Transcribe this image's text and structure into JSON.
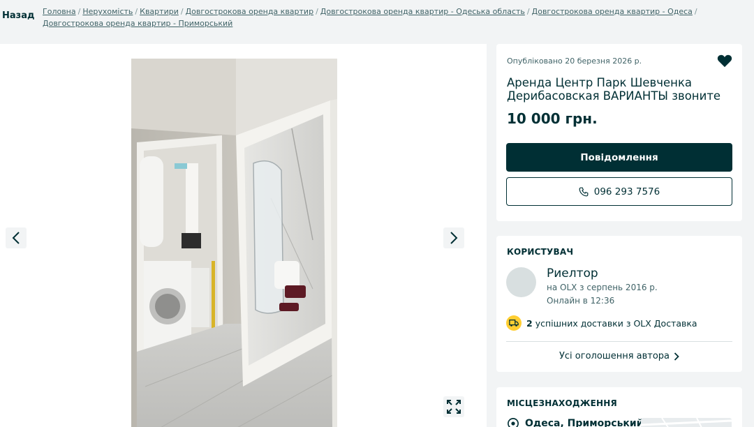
{
  "header": {
    "back_label": "Назад",
    "breadcrumbs": [
      "Головна",
      "Нерухомість",
      "Квартири",
      "Довгострокова оренда квартир",
      "Довгострокова оренда квартир - Одеська область",
      "Довгострокова оренда квартир - Одеса",
      "Довгострокова оренда квартир - Приморський"
    ],
    "separator": "/"
  },
  "listing": {
    "posted": "Опубліковано 20 березня 2026 р.",
    "title": "Аренда Центр Парк Шевченка Дерибасовская ВАРИАНТЫ звоните",
    "price": "10 000 грн.",
    "message_button": "Повідомлення",
    "phone": "096 293 7576"
  },
  "user": {
    "section_title": "Користувач",
    "name": "Риелтор",
    "since": "на OLX з серпень 2016 р.",
    "online": "Онлайн в 12:36",
    "deliveries_count": "2",
    "deliveries_text": "успішних доставки з OLX Доставка",
    "all_ads_label": "Усі оголошення автора"
  },
  "location": {
    "section_title": "Місцезнаходження",
    "place": "Одеса, Приморський"
  },
  "icons": {
    "favorite": "heart-icon",
    "phone": "phone-icon",
    "prev": "chevron-left-icon",
    "next": "chevron-right-icon",
    "expand": "expand-icon",
    "delivery": "truck-icon",
    "location": "location-pin-icon"
  },
  "colors": {
    "brand_dark": "#002f34",
    "accent_yellow": "#ffce32",
    "page_bg": "#f2f4f5"
  }
}
